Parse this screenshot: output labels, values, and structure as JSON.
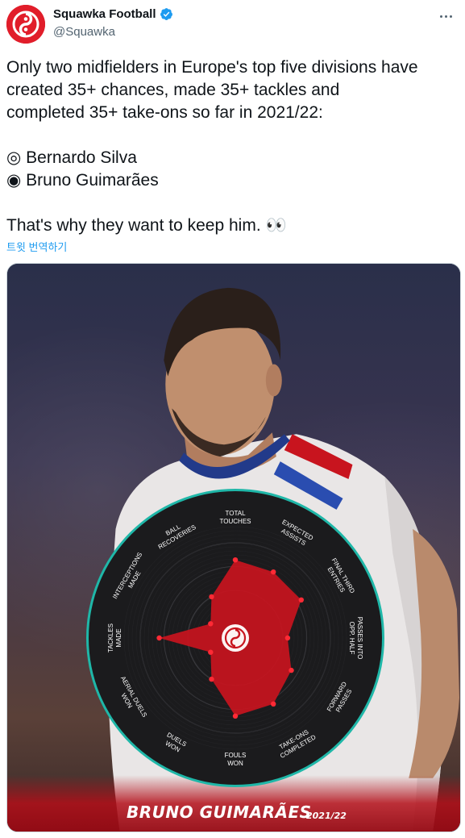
{
  "account": {
    "display_name": "Squawka Football",
    "handle": "@Squawka"
  },
  "tweet": {
    "line1": "Only two midfielders in Europe's top five divisions have",
    "line2": "created 35+ chances, made 35+ tackles and",
    "line3": "completed 35+ take-ons so far in 2021/22:",
    "item1": "◎ Bernardo Silva",
    "item2": "◉ Bruno Guimarães",
    "closing": "That's why they want to keep him. 👀",
    "translate_label": "트윗 번역하기"
  },
  "graphic": {
    "player_name": "BRUNO GUIMARÃES",
    "season": "2021/22"
  },
  "chart_data": {
    "type": "radar",
    "axes": [
      [
        "TOTAL",
        "TOUCHES"
      ],
      [
        "EXPECTED",
        "ASSISTS"
      ],
      [
        "FINAL THIRD",
        "ENTRIES"
      ],
      [
        "PASSES INTO",
        "OPP. HALF"
      ],
      [
        "FORWARD",
        "PASSES"
      ],
      [
        "TAKE-ONS",
        "COMPLETED"
      ],
      [
        "FOULS",
        "WON"
      ],
      [
        "DUELS",
        "WON"
      ],
      [
        "AERIAL DUELS",
        "WON"
      ],
      [
        "TACKLES",
        "MADE"
      ],
      [
        "INTERCEPTIONS",
        "MADE"
      ],
      [
        "BALL",
        "RECOVERIES"
      ]
    ],
    "values": [
      0.82,
      0.8,
      0.8,
      0.55,
      0.68,
      0.8,
      0.82,
      0.5,
      0.3,
      0.8,
      0.3,
      0.5
    ],
    "range": [
      0,
      1
    ],
    "colors": {
      "fill": "#c8141e",
      "ring": "#1fb7a8",
      "background": "#1b1b1d",
      "label": "#ffffff"
    }
  },
  "colors": {
    "brand_red": "#e11d2a",
    "link_blue": "#1d9bf0",
    "verified_blue": "#1d9bf0"
  }
}
